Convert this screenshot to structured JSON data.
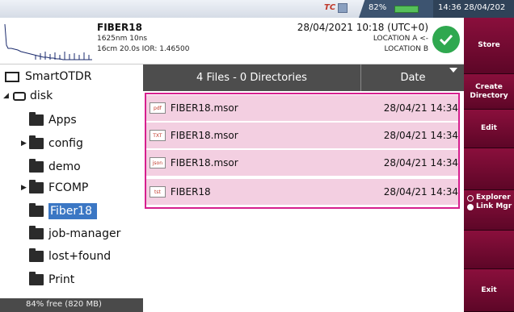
{
  "status": {
    "brand_icon": "tc-logo-icon",
    "battery_percent": "82%",
    "battery_level": 0.82,
    "clock": "14:36 28/04/202"
  },
  "header": {
    "file_name": "FIBER18",
    "line2": "1625nm  10ns",
    "line3": "16cm  20.0s  IOR: 1.46500",
    "datetime": "28/04/2021 10:18 (UTC+0)",
    "location_a": "LOCATION A <-",
    "location_b": "LOCATION B",
    "status_icon": "check-circle-icon",
    "status_color": "#2fa84f"
  },
  "tree": {
    "root_label": "SmartOTDR",
    "disk_label": "disk",
    "items": [
      {
        "label": "Apps"
      },
      {
        "label": "config"
      },
      {
        "label": "demo"
      },
      {
        "label": "FCOMP"
      },
      {
        "label": "Fiber18"
      },
      {
        "label": "job-manager"
      },
      {
        "label": "lost+found"
      },
      {
        "label": "Print"
      }
    ],
    "free_space": "84% free (820 MB)"
  },
  "filelist": {
    "header_count": "4 Files - 0 Directories",
    "header_date": "Date",
    "rows": [
      {
        "icon_label": "pdf",
        "name": "FIBER18.msor",
        "date": "28/04/21 14:34"
      },
      {
        "icon_label": "TXT",
        "name": "FIBER18.msor",
        "date": "28/04/21 14:34"
      },
      {
        "icon_label": "json",
        "name": "FIBER18.msor",
        "date": "28/04/21 14:34"
      },
      {
        "icon_label": "tst",
        "name": "FIBER18",
        "date": "28/04/21 14:34"
      }
    ],
    "selection_color": "#d61f8e"
  },
  "sidebar": {
    "store": "Store",
    "create_directory_1": "Create",
    "create_directory_2": "Directory",
    "edit": "Edit",
    "radio_explorer": "Explorer",
    "radio_link_mgr": "Link Mgr",
    "exit": "Exit",
    "accent_color": "#8a0f3c"
  }
}
